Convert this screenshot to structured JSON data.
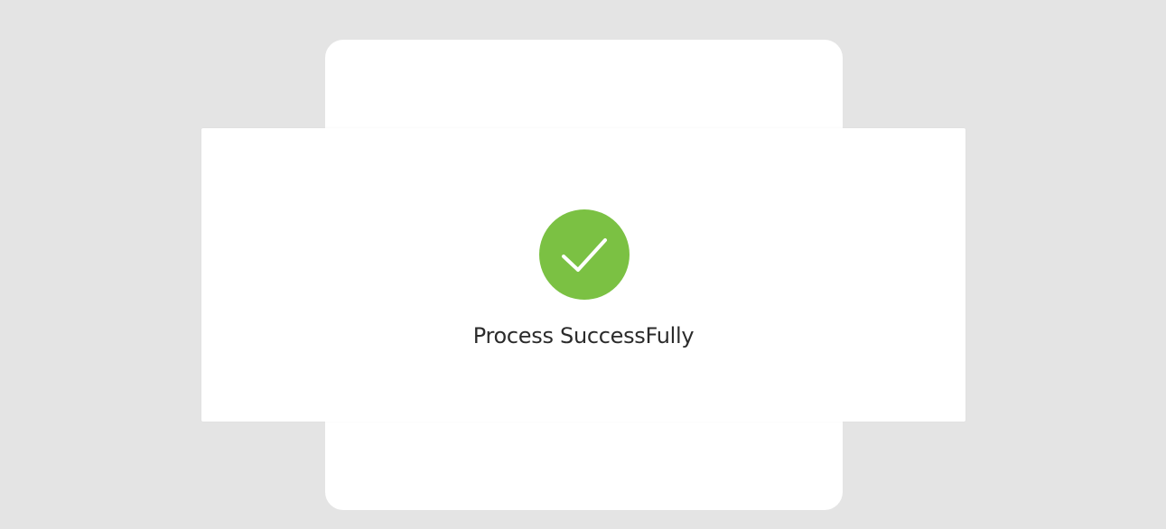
{
  "dialog": {
    "icon": "check-circle-icon",
    "icon_color": "#7bc143",
    "message": "Process SuccessFully"
  },
  "background": {
    "overlay_color": "#e4e4e4"
  }
}
